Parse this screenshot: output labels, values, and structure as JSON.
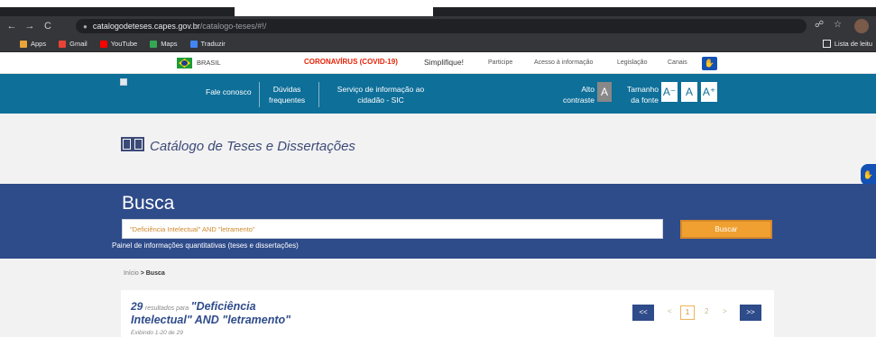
{
  "browser": {
    "url_host": "catalogodeteses.capes.gov.br",
    "url_path": "/catalogo-teses/#!/",
    "bookmarks": [
      {
        "label": "Apps",
        "color": "#e8a33a"
      },
      {
        "label": "Gmail",
        "color": "#ea4335"
      },
      {
        "label": "YouTube",
        "color": "#ff0000"
      },
      {
        "label": "Maps",
        "color": "#34a853"
      },
      {
        "label": "Traduzir",
        "color": "#4285f4"
      }
    ],
    "reading_list": "Lista de leitu"
  },
  "govbar": {
    "country": "BRASIL",
    "covid": "CORONAVÍRUS (COVID-19)",
    "simplifique": "Simplifique!",
    "participe": "Participe",
    "acesso": "Acesso à informação",
    "legislacao": "Legislação",
    "canais": "Canais"
  },
  "header": {
    "fale": "Fale conosco",
    "duvidas_1": "Dúvidas",
    "duvidas_2": "frequentes",
    "servico_1": "Serviço de informação ao",
    "servico_2": "cidadão - SIC",
    "alto_1": "Alto",
    "alto_2": "contraste",
    "contrast_btn": "A",
    "tamanho_1": "Tamanho",
    "tamanho_2": "da fonte",
    "font_minus": "A⁻",
    "font_normal": "A",
    "font_plus": "A⁺"
  },
  "catalog": {
    "title": "Catálogo de Teses e Dissertações"
  },
  "search": {
    "heading": "Busca",
    "query": "\"Deficiência Intelectual\" AND \"letramento\"",
    "button": "Buscar",
    "painel": "Painel de informações quantitativas (teses e dissertações)"
  },
  "breadcrumb": {
    "home": "Início",
    "sep": ">",
    "current": "Busca"
  },
  "results": {
    "count": "29",
    "for_label": "resultados para",
    "query_line1": "\"Deficiência",
    "query_line2": "Intelectual\" AND \"letramento\"",
    "showing": "Exibindo 1-20 de 29"
  },
  "pagination": {
    "first": "<<",
    "prev": "<",
    "page1": "1",
    "page2": "2",
    "next": ">",
    "last": ">>"
  }
}
